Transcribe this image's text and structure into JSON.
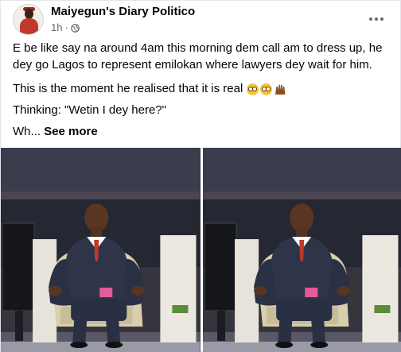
{
  "post": {
    "author": "Maiyegun's Diary Politico",
    "time": "1h",
    "dot": "·",
    "paragraph_1": "E be like say na around 4am this morning dem call am to dress up, he dey go Lagos to represent emilokan where lawyers dey wait for him.",
    "paragraph_2": "This is the moment he realised that it is real",
    "paragraph_3": "Thinking: \"Wetin I dey here?\"",
    "truncated": "Wh...",
    "see_more": "See more",
    "emojis": [
      "flushed-face",
      "flushed-face",
      "raised-hands-dark-skin"
    ]
  },
  "icons": {
    "globe": "globe-icon",
    "more": "more-options-icon"
  },
  "colors": {
    "text_primary": "#050505",
    "text_secondary": "#65676b",
    "suit": "#2e3448",
    "tie": "#c0392b",
    "chair": "#d8cfae",
    "stage_bg": "#2a2d38"
  }
}
